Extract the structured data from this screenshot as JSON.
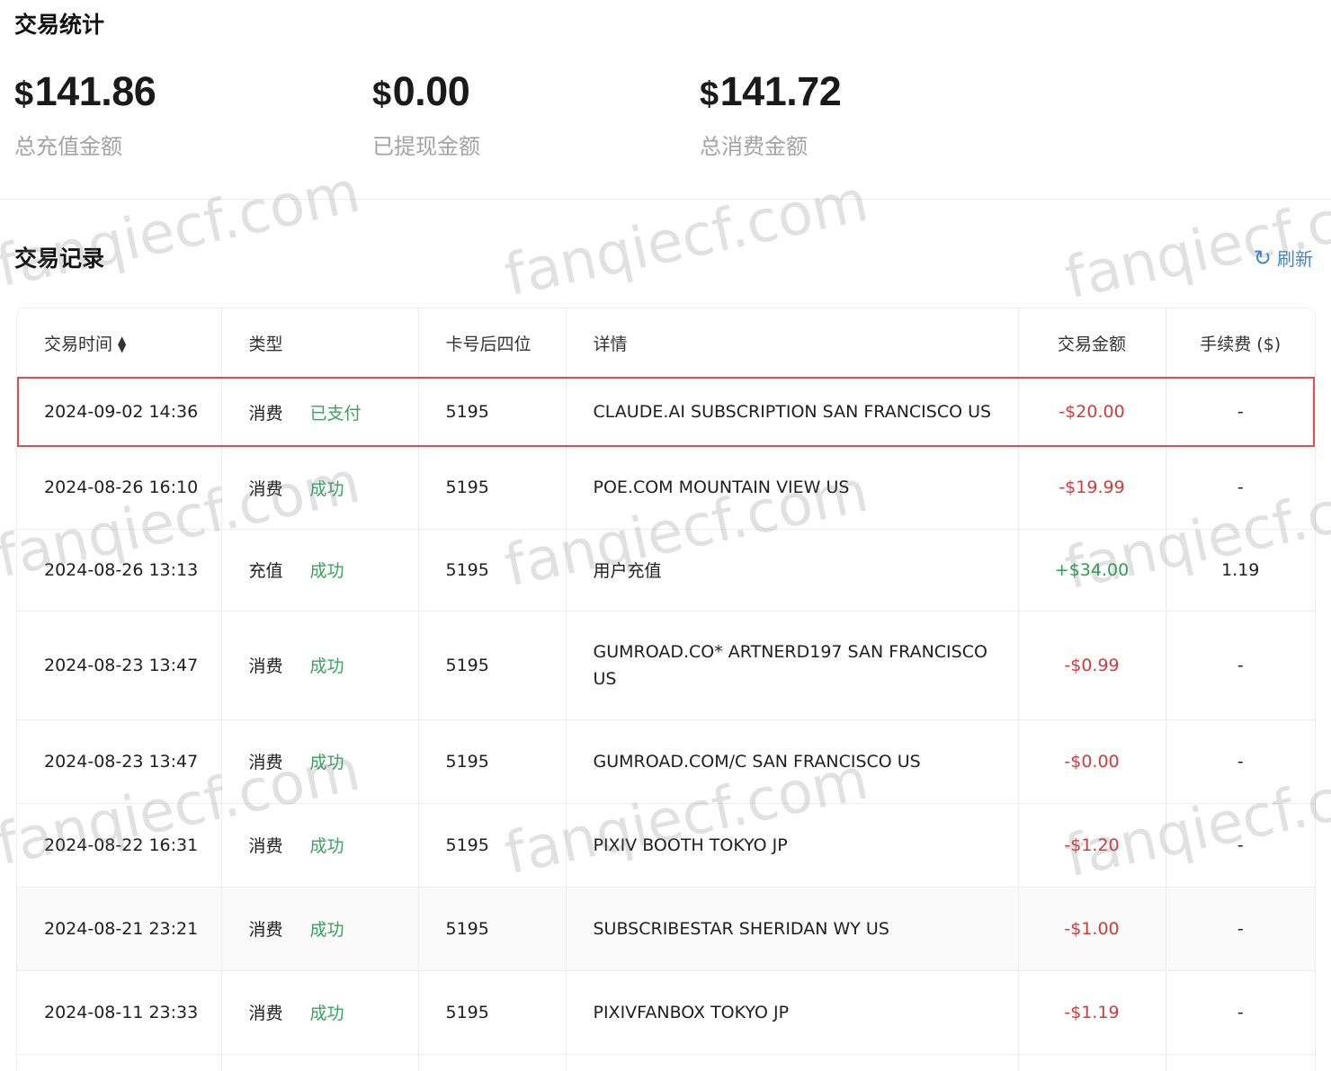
{
  "stats": {
    "title": "交易统计",
    "items": [
      {
        "currency": "$",
        "amount": "141.86",
        "label": "总充值金额"
      },
      {
        "currency": "$",
        "amount": "0.00",
        "label": "已提现金额"
      },
      {
        "currency": "$",
        "amount": "141.72",
        "label": "总消费金额"
      }
    ]
  },
  "records": {
    "title": "交易记录",
    "refresh_label": "刷新",
    "columns": [
      "交易时间",
      "类型",
      "卡号后四位",
      "详情",
      "交易金额",
      "手续费 ($)"
    ],
    "rows": [
      {
        "time": "2024-09-02 14:36",
        "type": "消费",
        "status": "已支付",
        "card": "5195",
        "detail": "CLAUDE.AI SUBSCRIPTION SAN FRANCISCO US",
        "amount": "-$20.00",
        "fee": "-"
      },
      {
        "time": "2024-08-26 16:10",
        "type": "消费",
        "status": "成功",
        "card": "5195",
        "detail": "POE.COM MOUNTAIN VIEW US",
        "amount": "-$19.99",
        "fee": "-"
      },
      {
        "time": "2024-08-26 13:13",
        "type": "充值",
        "status": "成功",
        "card": "5195",
        "detail": "用户充值",
        "amount": "+$34.00",
        "fee": "1.19"
      },
      {
        "time": "2024-08-23 13:47",
        "type": "消费",
        "status": "成功",
        "card": "5195",
        "detail": "GUMROAD.CO* ARTNERD197 SAN FRANCISCO US",
        "amount": "-$0.99",
        "fee": "-"
      },
      {
        "time": "2024-08-23 13:47",
        "type": "消费",
        "status": "成功",
        "card": "5195",
        "detail": "GUMROAD.COM/C SAN FRANCISCO US",
        "amount": "-$0.00",
        "fee": "-"
      },
      {
        "time": "2024-08-22 16:31",
        "type": "消费",
        "status": "成功",
        "card": "5195",
        "detail": "PIXIV BOOTH TOKYO JP",
        "amount": "-$1.20",
        "fee": "-"
      },
      {
        "time": "2024-08-21 23:21",
        "type": "消费",
        "status": "成功",
        "card": "5195",
        "detail": "SUBSCRIBESTAR SHERIDAN WY US",
        "amount": "-$1.00",
        "fee": "-"
      },
      {
        "time": "2024-08-11 23:33",
        "type": "消费",
        "status": "成功",
        "card": "5195",
        "detail": "PIXIVFANBOX TOKYO JP",
        "amount": "-$1.19",
        "fee": "-"
      }
    ]
  },
  "watermark": "fanqiecf.com",
  "colors": {
    "negative": "#d13b3b",
    "positive": "#2f9e54",
    "status": "#3aa35c",
    "highlight": "#e24c4c",
    "link": "#3a86d6"
  }
}
